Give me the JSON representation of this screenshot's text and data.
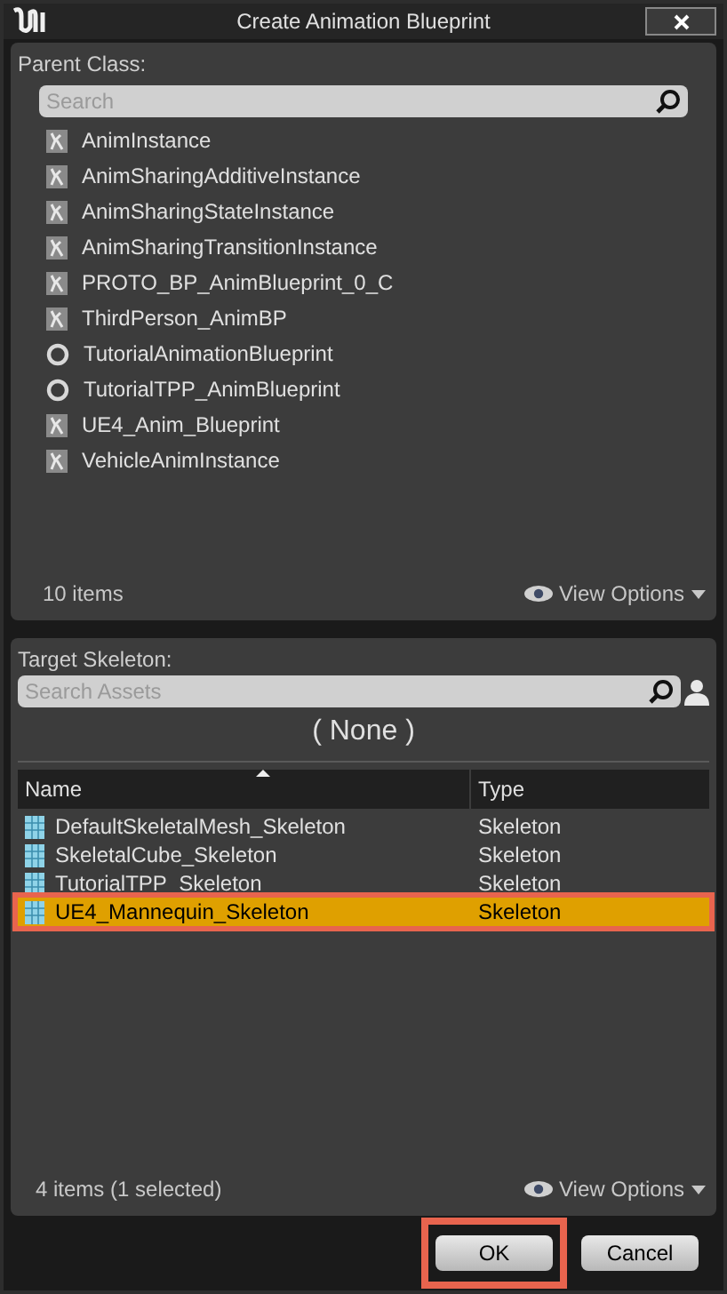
{
  "window": {
    "title": "Create Animation Blueprint"
  },
  "parent_class": {
    "label": "Parent Class:",
    "search": {
      "placeholder": "Search"
    },
    "items": [
      {
        "kind": "anim",
        "label": "AnimInstance"
      },
      {
        "kind": "anim",
        "label": "AnimSharingAdditiveInstance"
      },
      {
        "kind": "anim",
        "label": "AnimSharingStateInstance"
      },
      {
        "kind": "anim",
        "label": "AnimSharingTransitionInstance"
      },
      {
        "kind": "anim",
        "label": "PROTO_BP_AnimBlueprint_0_C"
      },
      {
        "kind": "anim",
        "label": "ThirdPerson_AnimBP"
      },
      {
        "kind": "circle",
        "label": "TutorialAnimationBlueprint"
      },
      {
        "kind": "circle",
        "label": "TutorialTPP_AnimBlueprint"
      },
      {
        "kind": "anim",
        "label": "UE4_Anim_Blueprint"
      },
      {
        "kind": "anim",
        "label": "VehicleAnimInstance"
      }
    ],
    "count": "10 items",
    "view_options": "View Options"
  },
  "target_skeleton": {
    "label": "Target Skeleton:",
    "search": {
      "placeholder": "Search Assets"
    },
    "current": "( None )",
    "columns": [
      "Name",
      "Type"
    ],
    "rows": [
      {
        "name": "DefaultSkeletalMesh_Skeleton",
        "type": "Skeleton",
        "selected": false,
        "highlighted": false
      },
      {
        "name": "SkeletalCube_Skeleton",
        "type": "Skeleton",
        "selected": false,
        "highlighted": false
      },
      {
        "name": "TutorialTPP_Skeleton",
        "type": "Skeleton",
        "selected": false,
        "highlighted": false
      },
      {
        "name": "UE4_Mannequin_Skeleton",
        "type": "Skeleton",
        "selected": true,
        "highlighted": true
      }
    ],
    "count": "4 items (1 selected)",
    "view_options": "View Options"
  },
  "buttons": [
    {
      "label": "OK",
      "highlighted": true
    },
    {
      "label": "Cancel",
      "highlighted": false
    }
  ]
}
